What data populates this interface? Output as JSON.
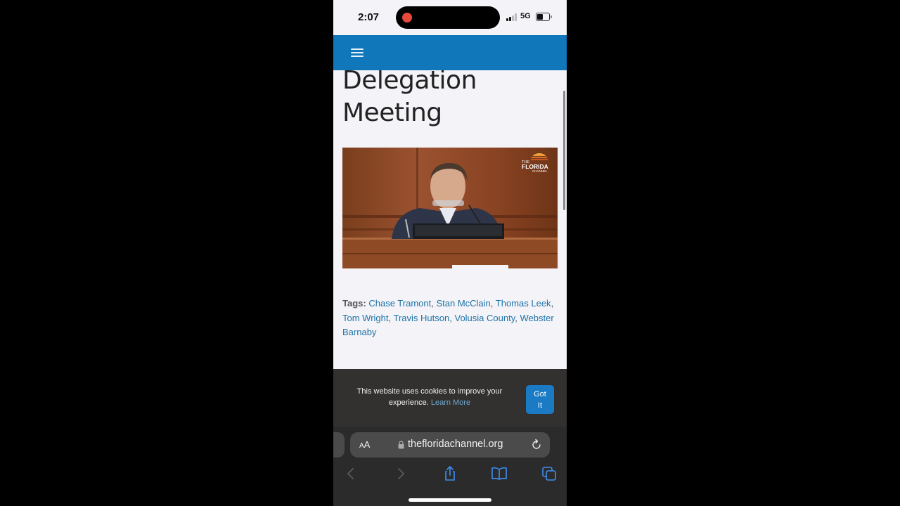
{
  "status_bar": {
    "time": "2:07",
    "network": "5G",
    "recording": true,
    "signal_bars_active": 2,
    "signal_bars_total": 4,
    "battery_level": 0.6
  },
  "navbar": {
    "menu_icon": "hamburger-icon",
    "color": "#1177bb"
  },
  "article": {
    "title_lines": [
      "Delegation",
      "Meeting"
    ],
    "video": {
      "watermark_line1": "THE",
      "watermark_line2": "FLORIDA",
      "watermark_line3": "CHANNEL"
    },
    "tags_label": "Tags:",
    "tags": [
      "Chase Tramont",
      "Stan McClain",
      "Thomas Leek",
      "Tom Wright",
      "Travis Hutson",
      "Volusia County",
      "Webster Barnaby"
    ],
    "tag_color": "#1d73a8"
  },
  "cookie_banner": {
    "text": "This website uses cookies to improve your experience.",
    "learn_more": "Learn More",
    "button_line1": "Got",
    "button_line2": "It"
  },
  "safari": {
    "aa_label_small": "A",
    "aa_label_large": "A",
    "url": "thefloridachannel.org",
    "icons": [
      "back-icon",
      "forward-icon",
      "share-icon",
      "bookmarks-icon",
      "tabs-icon"
    ],
    "accent": "#3f8ef0"
  }
}
